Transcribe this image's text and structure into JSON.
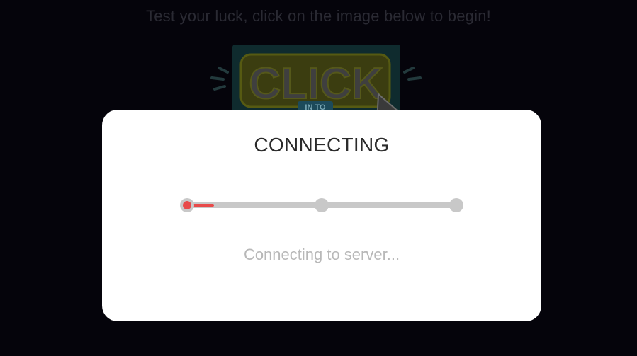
{
  "background": {
    "headline": "Test your luck, click on the image below to begin!",
    "promo": {
      "text_main": "CLICK",
      "text_small": "IN TO",
      "icon": "cursor-pointer-icon"
    }
  },
  "modal": {
    "title": "CONNECTING",
    "status": "Connecting to server...",
    "progress": {
      "steps": 3,
      "current_step": 1,
      "fill_fraction": 0.1
    }
  },
  "colors": {
    "background": "#05040b",
    "modal_bg": "#ffffff",
    "accent": "#e84a4a",
    "track": "#c8c8c8",
    "status_text": "#b8b8b8",
    "title_text": "#2b2b2b"
  }
}
